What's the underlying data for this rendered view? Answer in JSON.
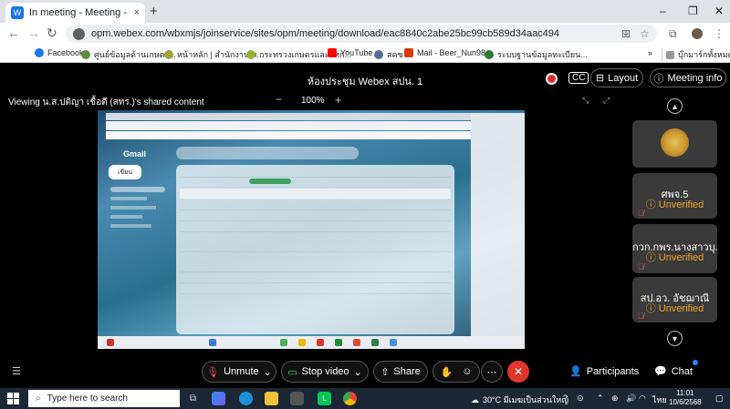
{
  "browser": {
    "tab_title": "In meeting - Meeting - Web",
    "tab_close": "×",
    "new_tab": "+",
    "url": "opm.webex.com/wbxmjs/joinservice/sites/opm/meeting/download/eac8840c2abe25bc99cb589d34aac494",
    "window_controls": [
      "–",
      "❐",
      "✕"
    ],
    "bookmarks": [
      {
        "label": "Facebook",
        "color": "#1877f2"
      },
      {
        "label": "ศูนย์ข้อมูลด้านเกษตร...",
        "color": "#5e8f3b"
      },
      {
        "label": "หน้าหลัก | สำนักงานเก...",
        "color": "#a3a140"
      },
      {
        "label": "กระทรวงเกษตรและสหก...",
        "color": "#8fb339"
      },
      {
        "label": "YouTube",
        "color": "#ff0000"
      },
      {
        "label": "สคช",
        "color": "#5a6b9a"
      },
      {
        "label": "Mail - Beer_Nun98...",
        "color": "#d83b01"
      },
      {
        "label": "ระบบฐานข้อมูลทะเบียน...",
        "color": "#2f7a3a"
      }
    ],
    "bookmarks_more": "»",
    "all_bookmarks": "บุ๊กมาร์กทั้งหมด"
  },
  "meeting": {
    "title": "ห้องประชุม Webex สปน. 1",
    "cc_label": "CC",
    "layout_label": "Layout",
    "info_label": "Meeting info",
    "viewing_label": "Viewing น.ส.ปติญา เชื้อดี (สทร.)'s shared content",
    "zoom_value": "100%",
    "zoom_minus": "−",
    "zoom_plus": "+"
  },
  "shared_content": {
    "gmail_label": "Gmail",
    "compose_label": "เขียน"
  },
  "participants": [
    {
      "name": "",
      "status": "",
      "has_logo": true
    },
    {
      "name": "ศพจ.5",
      "status": "Unverified"
    },
    {
      "name": "กวก.กพร.นางสาวบุ...",
      "status": "Unverified"
    },
    {
      "name": "สป.อว. อัชฌาณี",
      "status": "Unverified"
    }
  ],
  "controls": {
    "unmute": "Unmute",
    "stop_video": "Stop video",
    "share": "Share",
    "participants": "Participants",
    "chat": "Chat"
  },
  "taskbar": {
    "search_placeholder": "Type here to search",
    "weather": "30°C มีเมฆเป็นส่วนใหญ่",
    "language": "ไทย",
    "time": "11:01",
    "date": "10/6/2568"
  },
  "colors": {
    "accent_red": "#e0362c",
    "unverified": "#f1a728",
    "gmail_green": "#1e8e3e"
  }
}
